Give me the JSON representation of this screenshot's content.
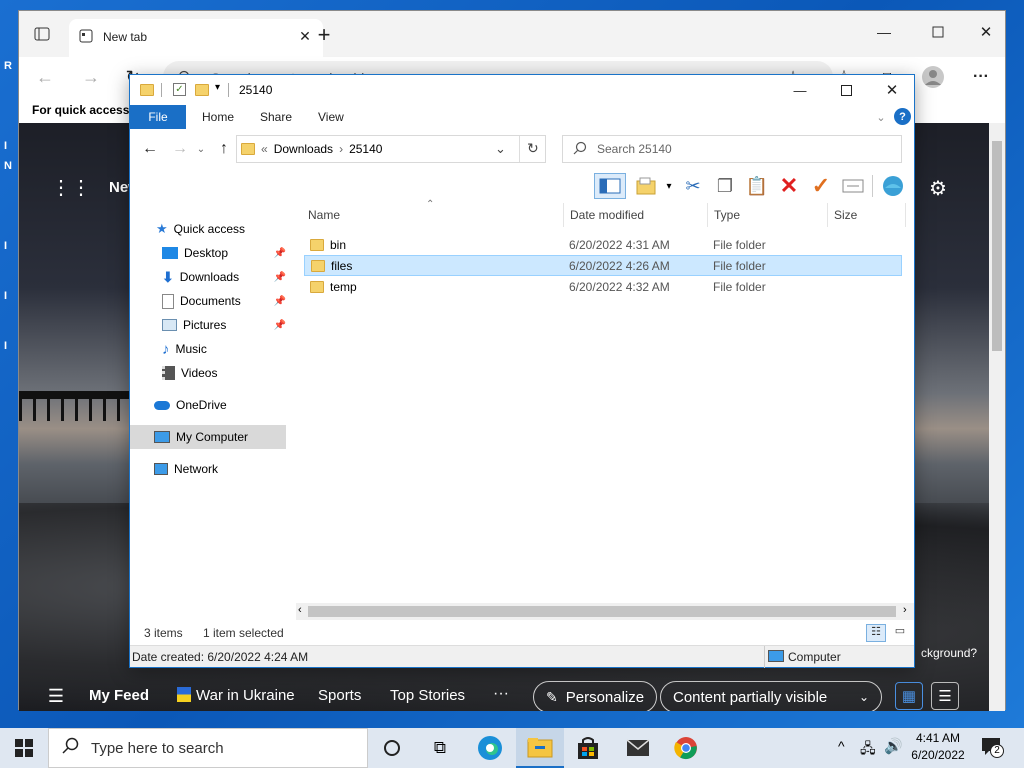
{
  "desktop": {
    "strip": [
      "R",
      "I",
      "N",
      "I",
      "I",
      "I"
    ]
  },
  "edge": {
    "tab_title": "New tab",
    "address_placeholder": "Search or enter web address",
    "fav_text": "For quick access, p",
    "page_title_partial": "New",
    "background_text": "ckground?",
    "feed": {
      "menu": "My Feed",
      "items": [
        "War in Ukraine",
        "Sports",
        "Top Stories"
      ],
      "more": "···",
      "personalize": "Personalize",
      "content_select": "Content partially visible"
    }
  },
  "explorer": {
    "title": "25140",
    "tabs": [
      "File",
      "Home",
      "Share",
      "View"
    ],
    "breadcrumb": {
      "prefix": "«",
      "items": [
        "Downloads",
        "25140"
      ]
    },
    "search_placeholder": "Search 25140",
    "nav": {
      "quick_access": "Quick access",
      "items": [
        {
          "label": "Desktop",
          "pinned": true
        },
        {
          "label": "Downloads",
          "pinned": true
        },
        {
          "label": "Documents",
          "pinned": true
        },
        {
          "label": "Pictures",
          "pinned": true
        },
        {
          "label": "Music",
          "pinned": false
        },
        {
          "label": "Videos",
          "pinned": false
        }
      ],
      "onedrive": "OneDrive",
      "computer": "My Computer",
      "network": "Network"
    },
    "columns": [
      "Name",
      "Date modified",
      "Type",
      "Size"
    ],
    "files": [
      {
        "name": "bin",
        "date": "6/20/2022 4:31 AM",
        "type": "File folder",
        "selected": false
      },
      {
        "name": "files",
        "date": "6/20/2022 4:26 AM",
        "type": "File folder",
        "selected": true
      },
      {
        "name": "temp",
        "date": "6/20/2022 4:32 AM",
        "type": "File folder",
        "selected": false
      }
    ],
    "status": {
      "count": "3 items",
      "selected": "1 item selected"
    },
    "details": {
      "created": "Date created: 6/20/2022 4:24 AM",
      "location": "Computer"
    }
  },
  "taskbar": {
    "search_placeholder": "Type here to search",
    "time": "4:41 AM",
    "date": "6/20/2022",
    "notifications": "2"
  },
  "colors": {
    "accent": "#0a64c8",
    "selection": "#cce8ff",
    "folder": "#f5d26b",
    "delete": "#e02020",
    "check": "#e07020"
  }
}
